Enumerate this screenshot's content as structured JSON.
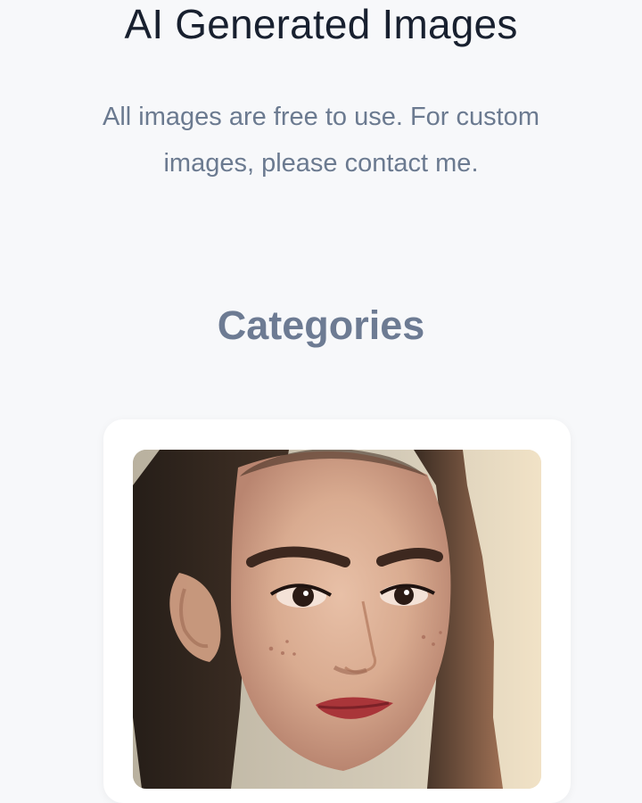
{
  "hero": {
    "title": "AI Generated Images",
    "subtitle": "All images are free to use. For custom images, please contact me."
  },
  "categories": {
    "heading": "Categories",
    "items": [
      {
        "image_subject": "portrait-image"
      }
    ]
  },
  "colors": {
    "background": "#f7f8fa",
    "title": "#18202f",
    "subtitle": "#6b7a90",
    "section_heading": "#6d7b93",
    "card": "#ffffff"
  }
}
